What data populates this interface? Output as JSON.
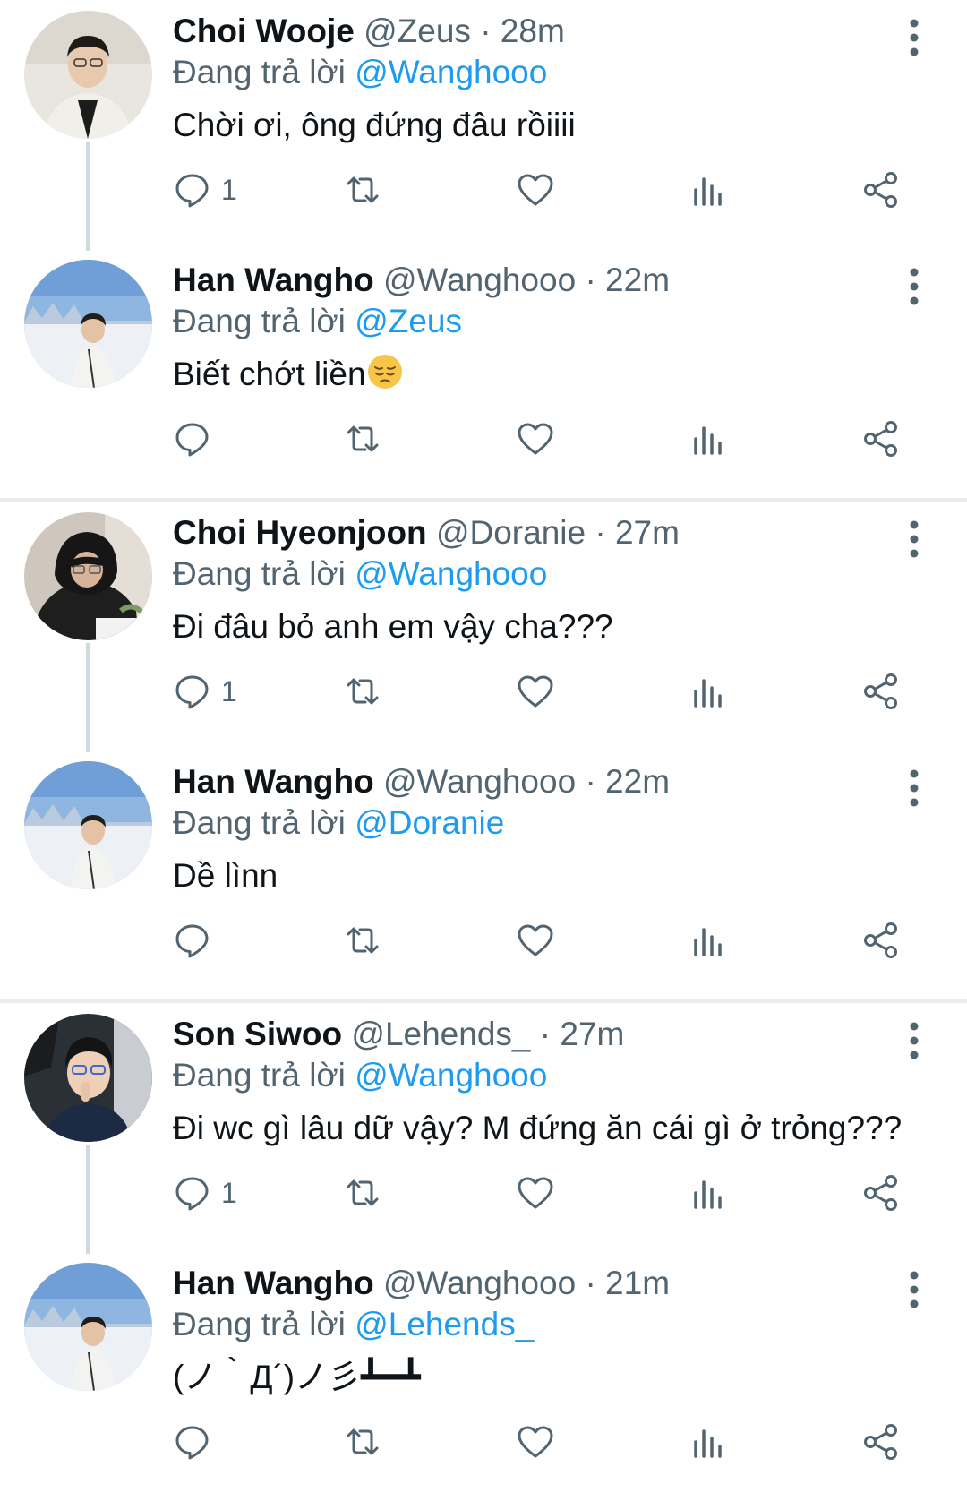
{
  "reply_prefix": "Đang trả lời",
  "colors": {
    "accent": "#1d9bf0",
    "secondary_text": "#536471",
    "separator": "#e6ecf0"
  },
  "icons": [
    "reply-icon",
    "retweet-icon",
    "like-icon",
    "views-icon",
    "share-icon",
    "more-icon"
  ],
  "threads": [
    {
      "tweets": [
        {
          "name": "Choi Wooje",
          "handle": "@Zeus",
          "time": "28m",
          "reply_to": "@Wanghooo",
          "text": "Chời ơi, ông đứng đâu rồiiii",
          "reply_count": "1"
        },
        {
          "name": "Han Wangho",
          "handle": "@Wanghooo",
          "time": "22m",
          "reply_to": "@Zeus",
          "text": "Biết chớt liền",
          "emoji": "pensive-face",
          "reply_count": ""
        }
      ]
    },
    {
      "tweets": [
        {
          "name": "Choi Hyeonjoon",
          "handle": "@Doranie",
          "time": "27m",
          "reply_to": "@Wanghooo",
          "text": "Đi đâu bỏ anh em vậy cha???",
          "reply_count": "1"
        },
        {
          "name": "Han Wangho",
          "handle": "@Wanghooo",
          "time": "22m",
          "reply_to": "@Doranie",
          "text": "Dề lìnn",
          "reply_count": ""
        }
      ]
    },
    {
      "tweets": [
        {
          "name": "Son Siwoo",
          "handle": "@Lehends_",
          "time": "27m",
          "reply_to": "@Wanghooo",
          "text": "Đi wc gì lâu dữ vậy? M đứng ăn cái gì ở trỏng???",
          "reply_count": "1"
        },
        {
          "name": "Han Wangho",
          "handle": "@Wanghooo",
          "time": "21m",
          "reply_to": "@Lehends_",
          "text": "(ノ｀Д´)ノ彡┻━┻",
          "reply_count": ""
        }
      ]
    }
  ]
}
